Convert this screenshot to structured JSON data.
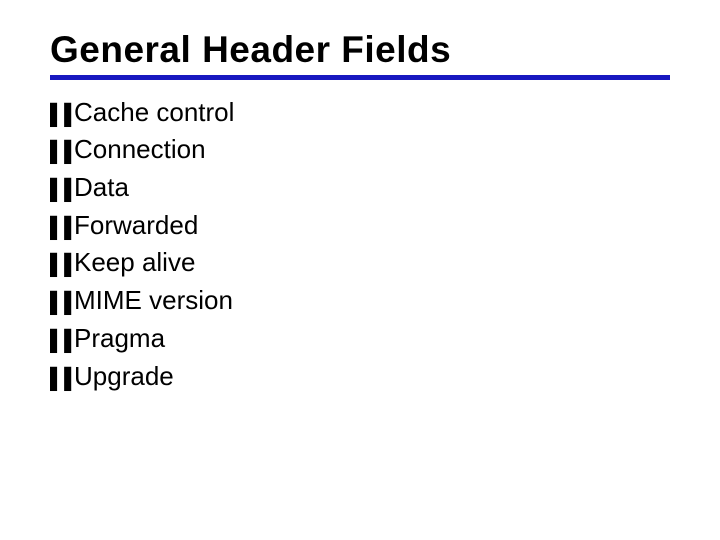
{
  "title": "General Header Fields",
  "bullet_glyph": "❚❚",
  "items": [
    "Cache control",
    "Connection",
    "Data",
    "Forwarded",
    "Keep alive",
    "MIME version",
    "Pragma",
    "Upgrade"
  ]
}
